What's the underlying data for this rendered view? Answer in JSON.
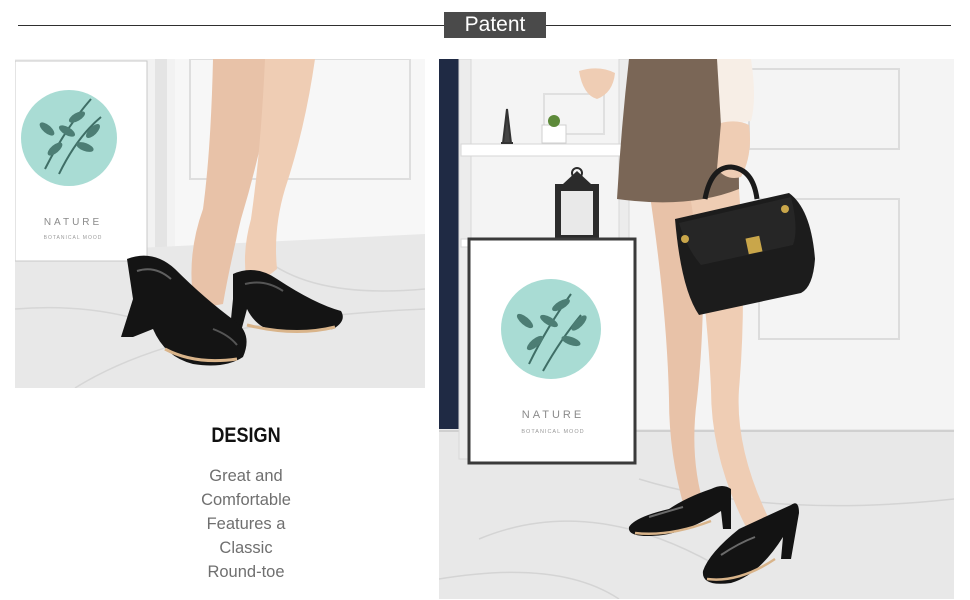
{
  "header": {
    "title": "Patent"
  },
  "design": {
    "heading": "DESIGN",
    "lines": [
      "Great and",
      "Comfortable",
      "Features a",
      "Classic",
      "Round-toe"
    ]
  },
  "poster": {
    "title": "NATURE",
    "subtitle": "BOTANICAL MOOD"
  },
  "colors": {
    "tag_bg": "#4a4a4a",
    "shoe": "#111111",
    "poster_circle": "#a9dcd4",
    "leaf": "#3f6e66",
    "wall": "#f4f4f4",
    "floor": "#e6e6e6",
    "skirt": "#7a6656"
  }
}
